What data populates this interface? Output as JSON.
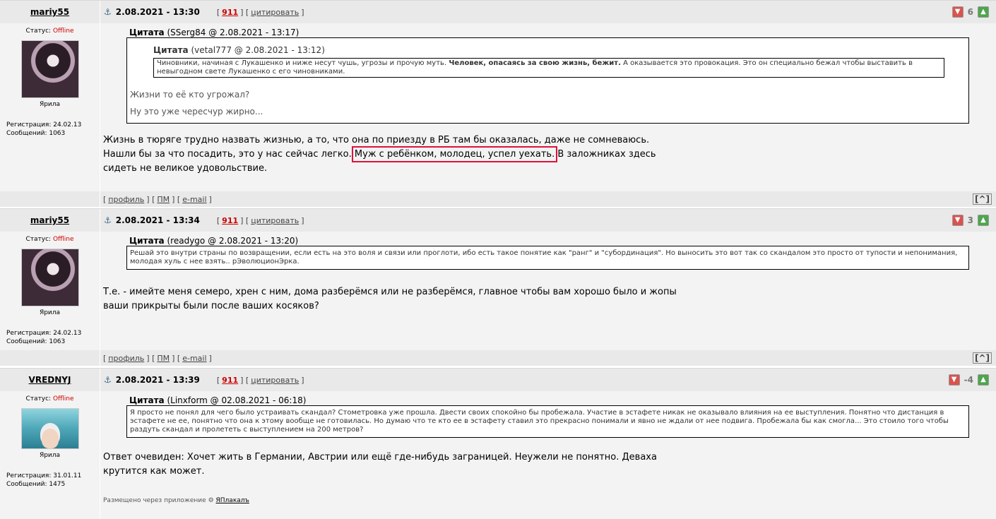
{
  "posts": [
    {
      "username": "mariy55",
      "date": "2.08.2021 - 13:30",
      "num": "911",
      "quote_label": "цитировать",
      "score": "6",
      "status_label": "Статус:",
      "status_value": "Offline",
      "avatar_title": "Ярила",
      "reg": "Регистрация: 24.02.13",
      "msgs": "Сообщений: 1063",
      "quote": {
        "title": "Цитата",
        "meta": "(SSerg84 @ 2.08.2021 - 13:17)",
        "nested_title": "Цитата",
        "nested_meta": "(vetal777 @ 2.08.2021 - 13:12)",
        "nested_text_1": "Чиновники, начиная с Лукашенко и ниже несут чушь, угрозы и прочую муть.",
        "nested_text_bold": "Человек, опасаясь за свою жизнь, бежит.",
        "nested_text_2": "А оказывается это провокация. Это он специально бежал чтобы выставить в невыгодном свете Лукашенко с его чиновниками.",
        "reply_1": "Жизни то её кто угрожал?",
        "reply_2": "Ну это уже чересчур жирно..."
      },
      "text_1": "Жизнь в тюряге трудно назвать жизнью, а то, что она по приезду в РБ там бы оказалась, даже не сомневаюсь. Нашли бы за что посадить, это у нас сейчас легко.",
      "text_highlight": "Муж с ребёнком, молодец, успел уехать.",
      "text_2": "В заложниках здесь сидеть не великое удовольствие."
    },
    {
      "username": "mariy55",
      "date": "2.08.2021 - 13:34",
      "num": "911",
      "quote_label": "цитировать",
      "score": "3",
      "status_label": "Статус:",
      "status_value": "Offline",
      "avatar_title": "Ярила",
      "reg": "Регистрация: 24.02.13",
      "msgs": "Сообщений: 1063",
      "quote": {
        "title": "Цитата",
        "meta": "(readygo @ 2.08.2021 - 13:20)",
        "text": "Решай это внутри страны по возвращении, если есть на это воля и связи или проглоти, ибо есть такое понятие как \"ранг\" и \"субординация\". Но выносить это вот так со скандалом это просто от тупости и непонимания, молодая хуль с нее взять.. рЭволюционЭрка."
      },
      "text": "Т.е. - имейте меня семеро, хрен с ним, дома разберёмся или не разберёмся, главное чтобы вам хорошо было и жопы ваши прикрыты были после ваших косяков?"
    },
    {
      "username": "VREDNYJ",
      "date": "2.08.2021 - 13:39",
      "num": "911",
      "quote_label": "цитировать",
      "score": "-4",
      "status_label": "Статус:",
      "status_value": "Offline",
      "avatar_title": "Ярила",
      "reg": "Регистрация: 31.01.11",
      "msgs": "Сообщений: 1475",
      "quote": {
        "title": "Цитата",
        "meta": "(Linxform @ 02.08.2021 - 06:18)",
        "text": "Я просто не понял для чего было устраивать скандал? Стометровка уже прошла. Двести своих спокойно бы пробежала. Участие в эстафете никак не оказывало влияния на ее выступления. Понятно что дистанция в эстафете не ее, понятно что она к этому вообще не готовилась. Но думаю что те кто ее в эстафету ставил это прекрасно понимали и явно не ждали от нее подвига. Пробежала бы как смогла... Это стоило того чтобы раздуть скандал и пролететь с выступлением на 200 метров?"
      },
      "text": "Ответ очевиден: Хочет жить в Германии, Австрии или ещё где-нибудь заграницей. Неужели не понятно. Деваха крутится как может.",
      "via_label": "Размещено через приложение",
      "via_app": "ЯПлакалъ"
    }
  ],
  "footer": {
    "profile": "профиль",
    "pm": "ПМ",
    "email": "e-mail",
    "up": "[^]"
  },
  "icons": {
    "anchor": "anchor-icon",
    "vote_down": "thumb-down-icon",
    "vote_up": "thumb-up-icon",
    "android": "android-icon"
  }
}
